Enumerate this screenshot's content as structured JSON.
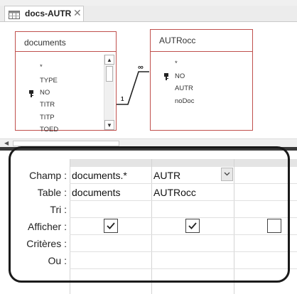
{
  "tab": {
    "label": "docs-AUTR",
    "close": "✕"
  },
  "tables": [
    {
      "name": "documents",
      "fields": [
        "*",
        "TYPE",
        "NO",
        "TITR",
        "TITP",
        "TOED"
      ]
    },
    {
      "name": "AUTRocc",
      "fields": [
        "*",
        "NO",
        "AUTR",
        "noDoc"
      ]
    }
  ],
  "relation": {
    "one": "1",
    "many": "∞"
  },
  "grid": {
    "row_labels": [
      "Champ :",
      "Table :",
      "Tri :",
      "Afficher :",
      "Critères :",
      "Ou :"
    ],
    "columns": [
      {
        "champ": "documents.*",
        "table": "documents",
        "afficher": true
      },
      {
        "champ": "AUTR",
        "table": "AUTRocc",
        "afficher": true
      },
      {
        "champ": "",
        "table": "",
        "afficher": false
      }
    ]
  },
  "icons": {
    "tab": "table-query-icon",
    "key": "primary-key-icon",
    "dropdown": "chevron-down-icon"
  }
}
